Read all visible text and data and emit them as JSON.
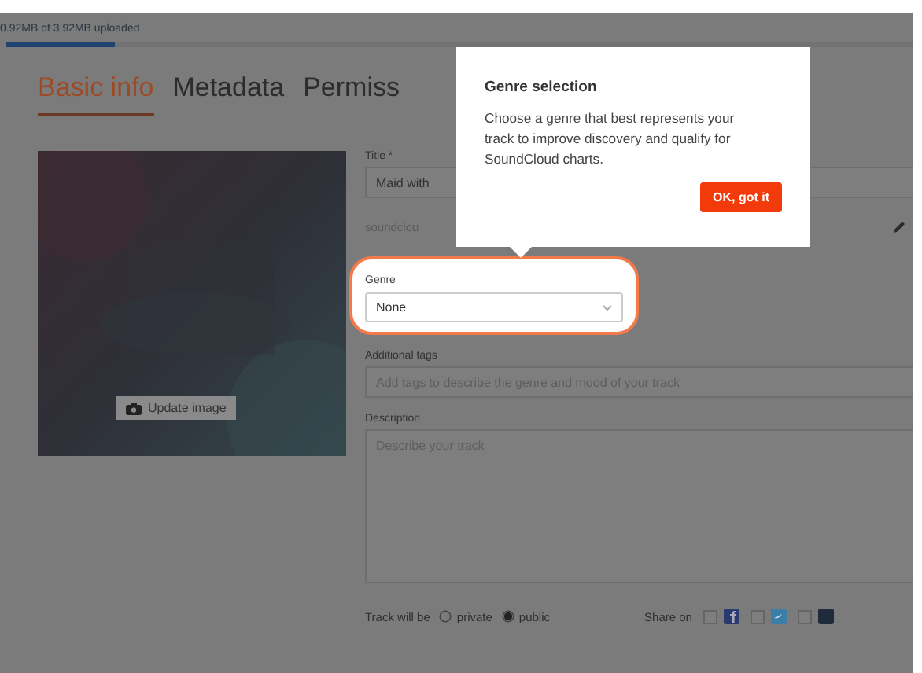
{
  "upload": {
    "status": "0.92MB of 3.92MB uploaded",
    "level": 0.12
  },
  "tabs": [
    {
      "label": "Basic info",
      "selected": true
    },
    {
      "label": "Metadata",
      "selected": false
    },
    {
      "label": "Permiss",
      "selected": false
    }
  ],
  "artwork": {
    "kind": "picture",
    "button": "Update image"
  },
  "fields": {
    "title_label": "Title *",
    "title_value": "Maid with",
    "url": "soundclou",
    "genre_label": "Genre",
    "genre_value": "None",
    "tags_label": "Additional tags",
    "tags_placeholder": "Add tags to describe the genre and mood of your track",
    "description_label": "Description",
    "description_placeholder": "Describe your track"
  },
  "privacy": {
    "label": "Track will be",
    "options": [
      {
        "label": "private",
        "selected": false
      },
      {
        "label": "public",
        "selected": true
      }
    ]
  },
  "share": {
    "label": "Share on",
    "services": [
      {
        "kind": "facebook",
        "checked": false
      },
      {
        "kind": "twitter",
        "checked": false
      },
      {
        "kind": "tumblr",
        "checked": false
      }
    ]
  },
  "tip": {
    "title": "Genre selection",
    "text": "Choose a genre that best represents your track to improve discovery and qualify for SoundCloud charts.",
    "button": "OK, got it"
  }
}
